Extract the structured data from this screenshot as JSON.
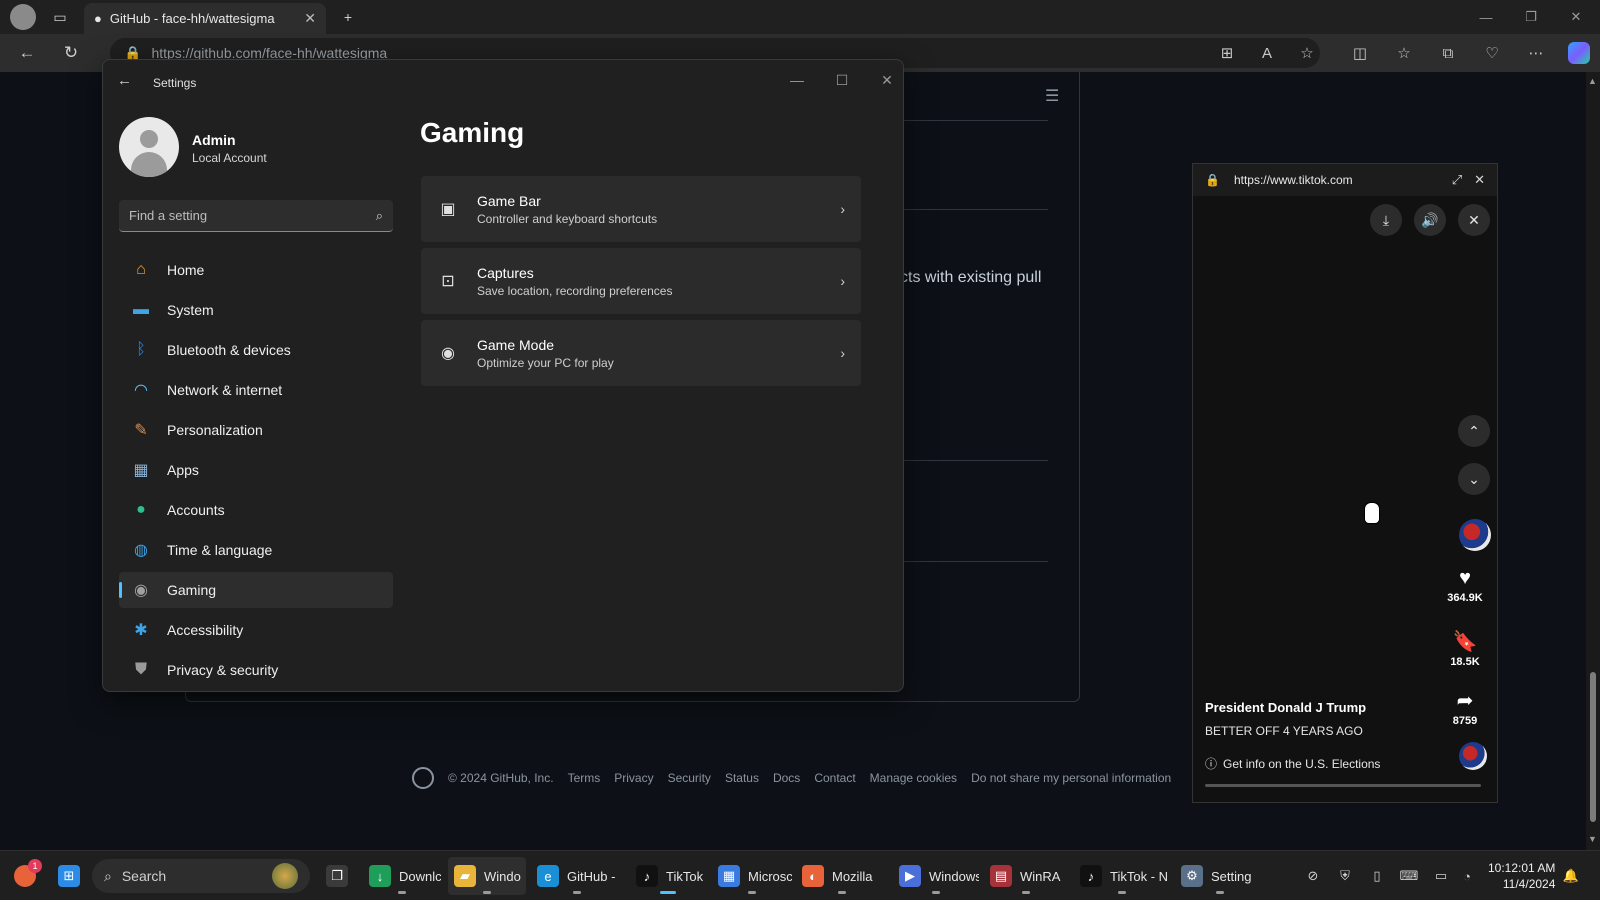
{
  "browser": {
    "tab_title": "GitHub - face-hh/wattesigma",
    "url": "https://github.com/face-hh/wattesigma"
  },
  "github": {
    "partial_text": "cts with existing pull",
    "footer": {
      "copyright": "© 2024 GitHub, Inc.",
      "links": [
        "Terms",
        "Privacy",
        "Security",
        "Status",
        "Docs",
        "Contact",
        "Manage cookies",
        "Do not share my personal information"
      ]
    }
  },
  "settings": {
    "window_title": "Settings",
    "user": {
      "name": "Admin",
      "account_type": "Local Account"
    },
    "search_placeholder": "Find a setting",
    "nav": [
      {
        "label": "Home",
        "icon": "home-icon",
        "color": "#f2a33a"
      },
      {
        "label": "System",
        "icon": "monitor-icon",
        "color": "#3fa3e8"
      },
      {
        "label": "Bluetooth & devices",
        "icon": "bluetooth-icon",
        "color": "#2f87e6"
      },
      {
        "label": "Network & internet",
        "icon": "wifi-icon",
        "color": "#5cc4f2"
      },
      {
        "label": "Personalization",
        "icon": "brush-icon",
        "color": "#e98b3e"
      },
      {
        "label": "Apps",
        "icon": "apps-icon",
        "color": "#8ab0d6"
      },
      {
        "label": "Accounts",
        "icon": "person-icon",
        "color": "#2fbf8c"
      },
      {
        "label": "Time & language",
        "icon": "globe-clock-icon",
        "color": "#3aa0e6"
      },
      {
        "label": "Gaming",
        "icon": "controller-icon",
        "color": "#a0a0a0",
        "active": true
      },
      {
        "label": "Accessibility",
        "icon": "accessibility-icon",
        "color": "#3fa3e8"
      },
      {
        "label": "Privacy & security",
        "icon": "shield-icon",
        "color": "#9a9a9a"
      }
    ],
    "page_title": "Gaming",
    "cards": [
      {
        "title": "Game Bar",
        "subtitle": "Controller and keyboard shortcuts",
        "icon": "game-bar-icon"
      },
      {
        "title": "Captures",
        "subtitle": "Save location, recording preferences",
        "icon": "capture-icon"
      },
      {
        "title": "Game Mode",
        "subtitle": "Optimize your PC for play",
        "icon": "gamepad-icon"
      }
    ]
  },
  "pip": {
    "url": "https://www.tiktok.com",
    "likes": "364.9K",
    "saves": "18.5K",
    "shares": "8759",
    "author": "President Donald J Trump",
    "caption": "BETTER OFF 4 YEARS AGO",
    "info": "Get info on the U.S. Elections"
  },
  "taskbar": {
    "search_label": "Search",
    "notification_badge": "1",
    "items": [
      {
        "label": "Downlc",
        "icon": "download-icon",
        "color": "#1f9e5a"
      },
      {
        "label": "Windo",
        "icon": "folder-icon",
        "color": "#e8b43a"
      },
      {
        "label": "GitHub -",
        "icon": "edge-icon",
        "color": "#1a8fd6"
      },
      {
        "label": "TikTok",
        "icon": "tiktok-icon",
        "color": "#111111"
      },
      {
        "label": "Microsc",
        "icon": "store-icon",
        "color": "#3a7be0"
      },
      {
        "label": "Mozilla",
        "icon": "firefox-icon",
        "color": "#e8623a"
      },
      {
        "label": "Windows",
        "icon": "media-icon",
        "color": "#4a6fd8"
      },
      {
        "label": "WinRA",
        "icon": "winrar-icon",
        "color": "#a8323a"
      },
      {
        "label": "TikTok - N",
        "icon": "tiktok-icon",
        "color": "#111111"
      },
      {
        "label": "Setting",
        "icon": "settings-gear-icon",
        "color": "#5a6f8a"
      }
    ],
    "time": "10:12:01 AM",
    "date": "11/4/2024"
  }
}
